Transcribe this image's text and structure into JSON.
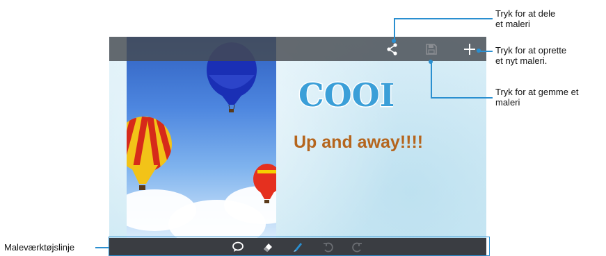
{
  "callouts": {
    "share": {
      "line1": "Tryk for at dele",
      "line2": "et maleri"
    },
    "new": {
      "line1": "Tryk for at oprette",
      "line2": "et nyt maleri."
    },
    "save": {
      "line1": "Tryk for at gemme et",
      "line2": "maleri"
    },
    "toolbar": {
      "label": "Maleværktøjslinje"
    }
  },
  "canvas": {
    "logo_text": "COOL",
    "caption": "Up and away!!!!"
  },
  "icons": {
    "share": "share-icon",
    "save": "save-icon",
    "add": "plus-icon",
    "text": "speech-bubble-icon",
    "eraser": "eraser-icon",
    "brush": "brush-icon",
    "undo": "undo-icon",
    "redo": "redo-icon"
  },
  "colors": {
    "callout": "#2a8fd0",
    "caption": "#b5651d",
    "brush": "#2a8fd0"
  }
}
